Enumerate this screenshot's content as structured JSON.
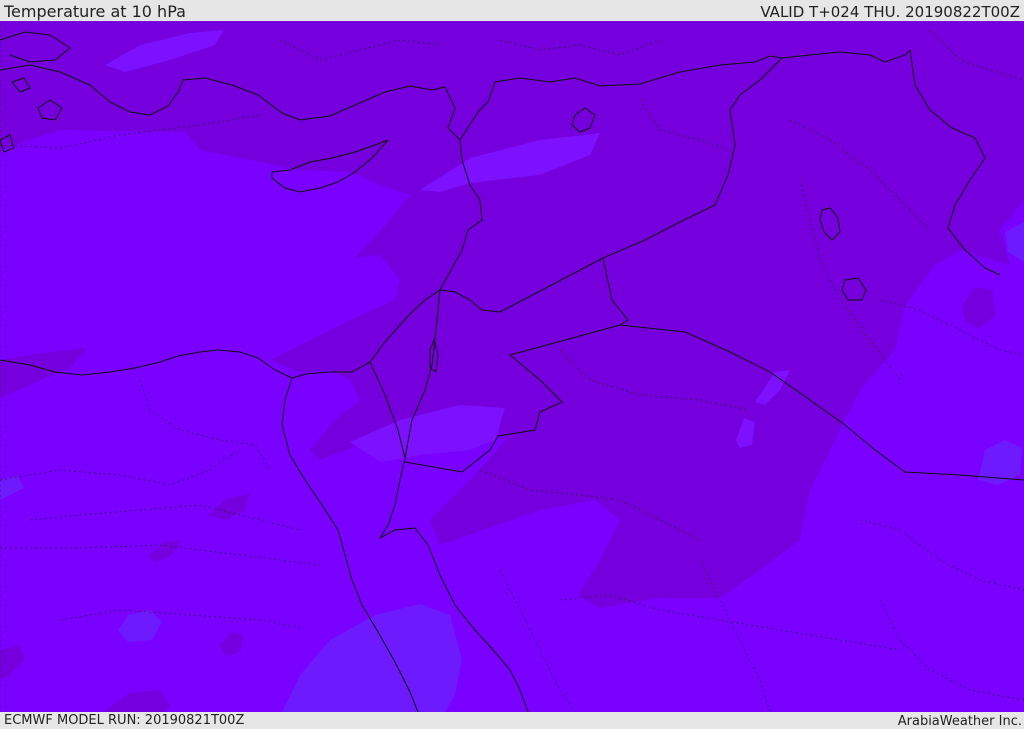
{
  "header": {
    "title": "Temperature at 10 hPa",
    "valid": "VALID T+024 THU. 20190822T00Z"
  },
  "footer": {
    "model_run": "ECMWF MODEL RUN: 20190821T00Z",
    "credit": "ArabiaWeather Inc."
  },
  "colors": {
    "base_fill": "#7a00ff",
    "warm_fill": "#7500dd",
    "cool_fill": "#6d1aff",
    "light_fill": "#7d10ff",
    "coastline": "#111111",
    "bar_background": "#e6e6e6"
  }
}
